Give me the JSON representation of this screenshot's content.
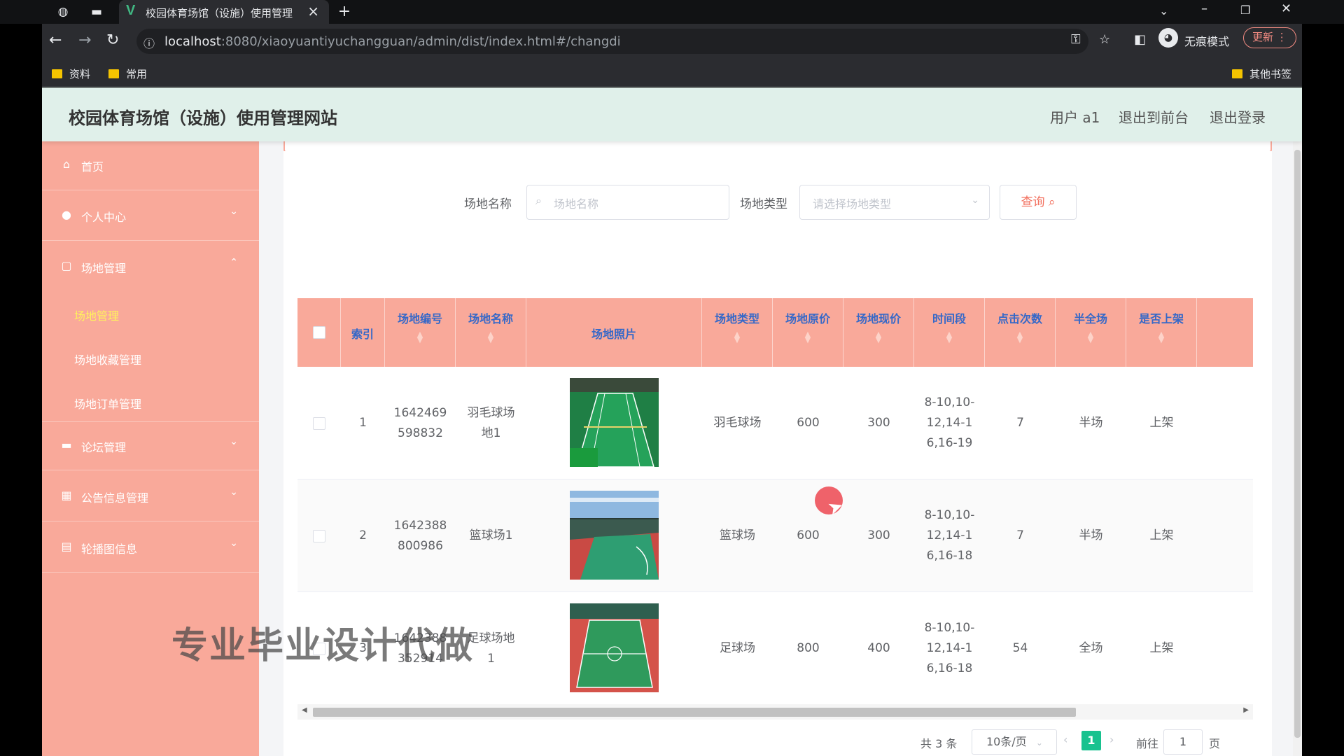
{
  "browser": {
    "tab_title": "校园体育场馆（设施）使用管理",
    "url_host": "localhost",
    "url_rest": ":8080/xiaoyuantiyuchangguan/admin/dist/index.html#/changdi",
    "incognito_label": "无痕模式",
    "update_label": "更新",
    "bookmarks": [
      "资料",
      "常用"
    ],
    "other_bookmarks": "其他书签"
  },
  "header": {
    "title": "校园体育场馆（设施）使用管理网站",
    "user": "用户 a1",
    "to_front": "退出到前台",
    "logout": "退出登录"
  },
  "sidebar": {
    "home": "首页",
    "personal": "个人中心",
    "venue_mgmt": "场地管理",
    "sub": [
      "场地管理",
      "场地收藏管理",
      "场地订单管理"
    ],
    "forum": "论坛管理",
    "notice": "公告信息管理",
    "carousel": "轮播图信息"
  },
  "search": {
    "name_label": "场地名称",
    "name_placeholder": "场地名称",
    "type_label": "场地类型",
    "type_placeholder": "请选择场地类型",
    "query_button": "查询"
  },
  "table": {
    "headers": {
      "index": "索引",
      "code": "场地编号",
      "name": "场地名称",
      "photo": "场地照片",
      "type": "场地类型",
      "orig_price": "场地原价",
      "cur_price": "场地现价",
      "time_slot": "时间段",
      "clicks": "点击次数",
      "half_full": "半全场",
      "listed": "是否上架"
    },
    "rows": [
      {
        "index": "1",
        "code": "1642469\n598832",
        "name": "羽毛球场\n地1",
        "type": "羽毛球场",
        "orig_price": "600",
        "cur_price": "300",
        "time_slot": "8-10,10-\n12,14-1\n6,16-19",
        "clicks": "7",
        "half_full": "半场",
        "listed": "上架"
      },
      {
        "index": "2",
        "code": "1642388\n800986",
        "name": "篮球场1",
        "type": "篮球场",
        "orig_price": "600",
        "cur_price": "300",
        "time_slot": "8-10,10-\n12,14-1\n6,16-18",
        "clicks": "7",
        "half_full": "半场",
        "listed": "上架"
      },
      {
        "index": "3",
        "code": "1642388\n352914",
        "name": "足球场地\n1",
        "type": "足球场",
        "orig_price": "800",
        "cur_price": "400",
        "time_slot": "8-10,10-\n12,14-1\n6,16-18",
        "clicks": "54",
        "half_full": "全场",
        "listed": "上架"
      }
    ]
  },
  "pagination": {
    "total": "共 3 条",
    "page_size": "10条/页",
    "current": "1",
    "goto_label": "前往",
    "goto_value": "1",
    "page_suffix": "页"
  },
  "watermark": "专业毕业设计代做",
  "colors": {
    "sidebar": "#f9a99a",
    "header": "#e0f0ea",
    "accent": "#f26d5b",
    "header_text": "#3568c8",
    "active_sub": "#fff35c",
    "page_active": "#18c28f"
  }
}
